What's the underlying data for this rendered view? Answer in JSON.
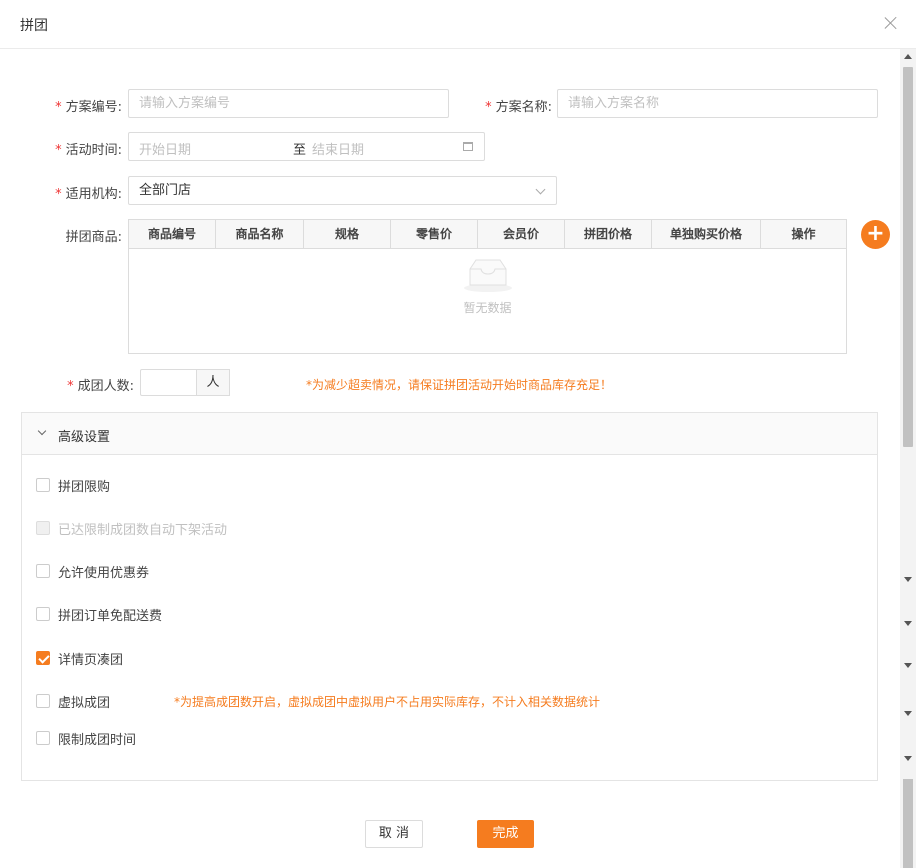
{
  "dialog": {
    "title": "拼团"
  },
  "form": {
    "scheme_no": {
      "label": "方案编号:",
      "placeholder": "请输入方案编号"
    },
    "scheme_name": {
      "label": "方案名称:",
      "placeholder": "请输入方案名称"
    },
    "activity_time": {
      "label": "活动时间:",
      "start_placeholder": "开始日期",
      "separator": "至",
      "end_placeholder": "结束日期"
    },
    "org": {
      "label": "适用机构:",
      "value": "全部门店"
    },
    "goods": {
      "label": "拼团商品:",
      "columns": [
        "商品编号",
        "商品名称",
        "规格",
        "零售价",
        "会员价",
        "拼团价格",
        "单独购买价格",
        "操作"
      ],
      "empty_text": "暂无数据",
      "add_label": "+"
    },
    "group_size": {
      "label": "成团人数:",
      "value": "",
      "unit": "人",
      "tip": "*为减少超卖情况，请保证拼团活动开始时商品库存充足！"
    }
  },
  "advanced": {
    "title": "高级设置",
    "options": [
      {
        "label": "拼团限购",
        "checked": false,
        "disabled": false
      },
      {
        "label": "已达限制成团数自动下架活动",
        "checked": false,
        "disabled": true
      },
      {
        "label": "允许使用优惠券",
        "checked": false,
        "disabled": false
      },
      {
        "label": "拼团订单免配送费",
        "checked": false,
        "disabled": false
      },
      {
        "label": "详情页凑团",
        "checked": true,
        "disabled": false
      },
      {
        "label": "虚拟成团",
        "checked": false,
        "disabled": false
      },
      {
        "label": "限制成团时间",
        "checked": false,
        "disabled": false
      }
    ],
    "virtual_tip": "*为提高成团数开启，虚拟成团中虚拟用户不占用实际库存，不计入相关数据统计"
  },
  "footer": {
    "cancel_label": "取 消",
    "ok_label": "完成"
  },
  "colors": {
    "accent": "#f57c1f",
    "required": "#e33333"
  }
}
